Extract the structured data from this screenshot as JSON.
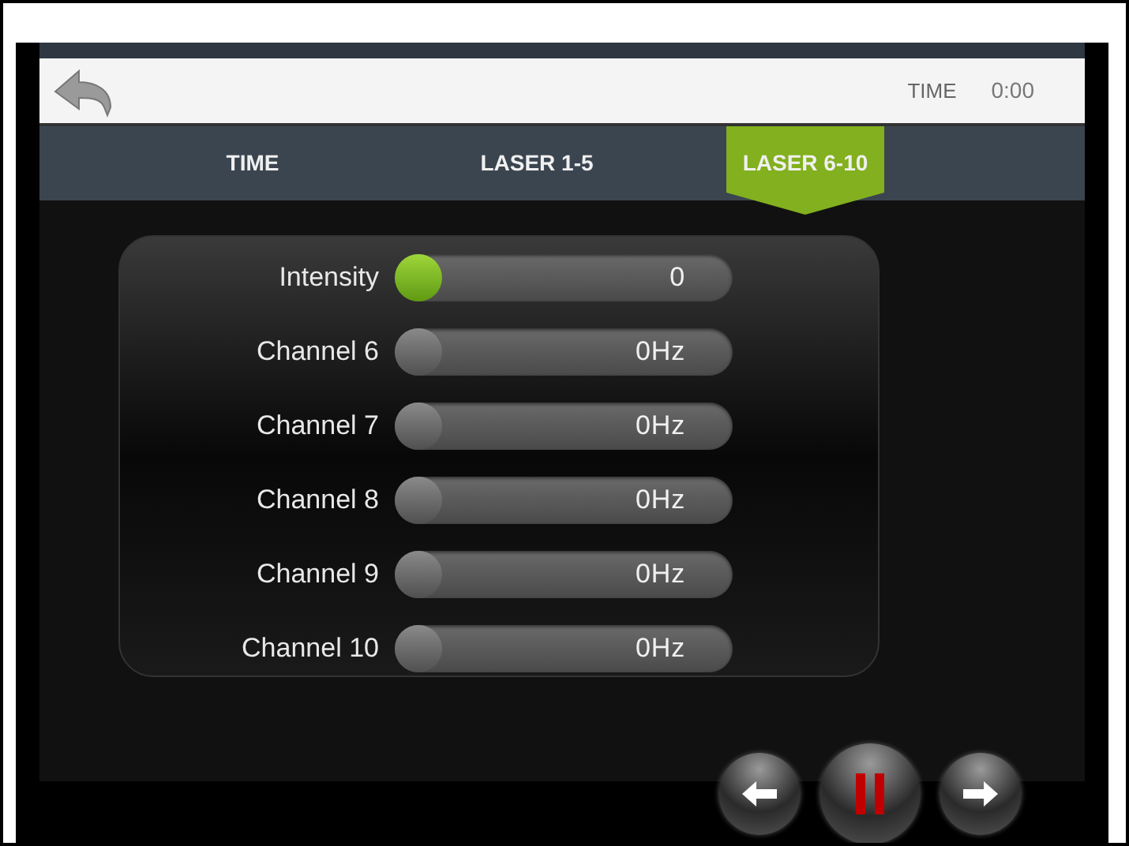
{
  "header": {
    "time_label": "TIME",
    "time_value": "0:00"
  },
  "tabs": [
    {
      "label": "TIME",
      "selected": false
    },
    {
      "label": "LASER 1-5",
      "selected": false
    },
    {
      "label": "LASER 6-10",
      "selected": true
    }
  ],
  "sliders": [
    {
      "label": "Intensity",
      "value": "0",
      "level": 0,
      "active": true
    },
    {
      "label": "Channel 6",
      "value": "0Hz",
      "level": 0,
      "active": false
    },
    {
      "label": "Channel 7",
      "value": "0Hz",
      "level": 0,
      "active": false
    },
    {
      "label": "Channel 8",
      "value": "0Hz",
      "level": 0,
      "active": false
    },
    {
      "label": "Channel 9",
      "value": "0Hz",
      "level": 0,
      "active": false
    },
    {
      "label": "Channel 10",
      "value": "0Hz",
      "level": 0,
      "active": false
    }
  ]
}
